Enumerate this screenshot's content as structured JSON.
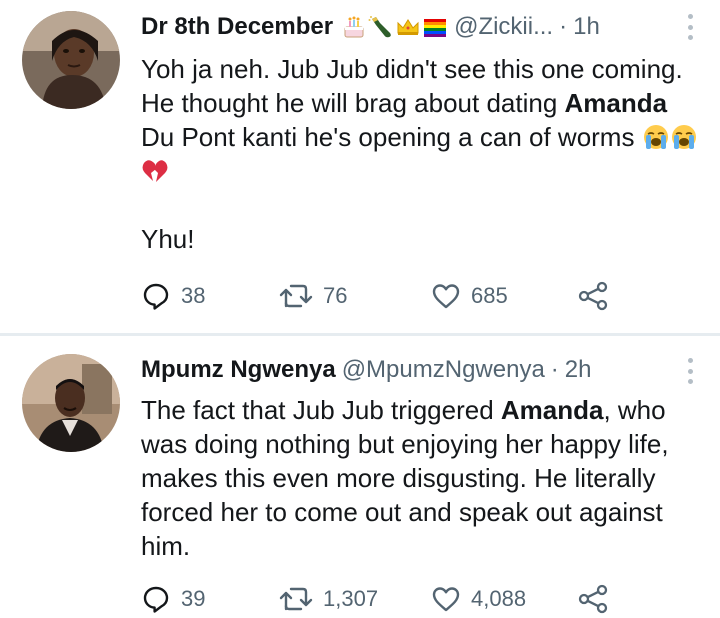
{
  "tweets": [
    {
      "author": "Dr 8th December",
      "name_emojis": [
        "birthday-cake",
        "champagne-bottle",
        "crown",
        "rainbow-flag"
      ],
      "handle": "@Zickii...",
      "separator": "·",
      "time": "1h",
      "text": {
        "line1": "Yoh ja neh. Jub Jub didn't see this one coming. He thought he will brag about dating ",
        "bold": "Amanda",
        "line2": " Du Pont kanti he's opening a can of worms ",
        "trailing_emojis": [
          "loudly-crying-face",
          "loudly-crying-face",
          "broken-heart"
        ],
        "line3": "Yhu!"
      },
      "stats": {
        "replies": "38",
        "retweets": "76",
        "likes": "685"
      }
    },
    {
      "author": "Mpumz Ngwenya",
      "handle": "@MpumzNgwenya",
      "separator": "·",
      "time": "2h",
      "text": {
        "before": "The fact that Jub Jub triggered ",
        "bold": "Amanda",
        "after": ", who was doing nothing but enjoying her happy life, makes this even more disgusting. He literally forced her to come out and speak out against him."
      },
      "stats": {
        "replies": "39",
        "retweets": "1,307",
        "likes": "4,088"
      }
    }
  ],
  "icons": [
    "reply-icon",
    "retweet-icon",
    "like-icon",
    "share-icon",
    "more-options-icon"
  ],
  "colors": {
    "text": "#14171a",
    "secondary": "#536471",
    "divider": "#e6ecf0"
  }
}
